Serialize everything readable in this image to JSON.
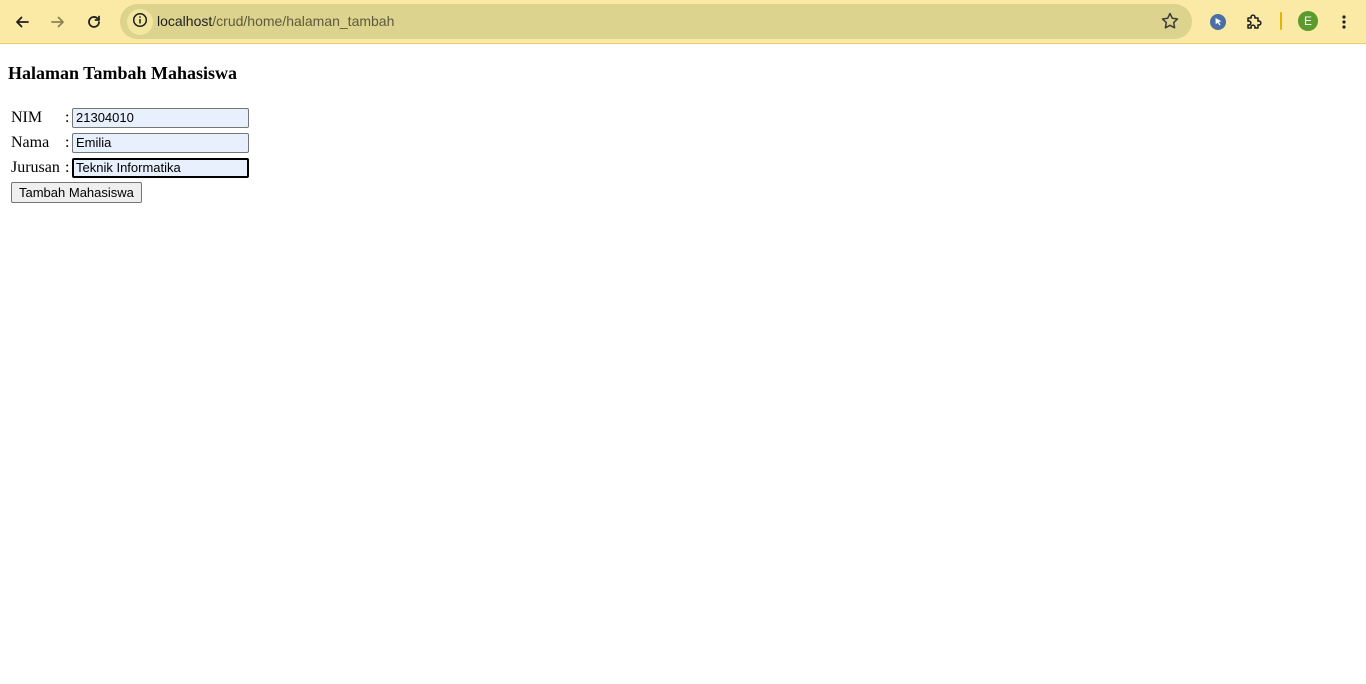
{
  "browser": {
    "url_host": "localhost",
    "url_path": "/crud/home/halaman_tambah",
    "profile_initial": "E",
    "icons": {
      "back": "back-arrow-icon",
      "forward": "forward-arrow-icon",
      "reload": "reload-icon",
      "site_info": "info-icon",
      "bookmark": "star-icon",
      "extension_1": "cursor-extension-icon",
      "extensions": "puzzle-icon",
      "menu": "kebab-menu-icon"
    },
    "colors": {
      "toolbar": "#fbe9a6",
      "omnibox": "#dcd38e",
      "avatar": "#5b9a2d"
    }
  },
  "page": {
    "heading": "Halaman Tambah Mahasiswa",
    "form": {
      "nim": {
        "label": "NIM",
        "colon": ":",
        "value": "21304010"
      },
      "nama": {
        "label": "Nama",
        "colon": ":",
        "value": "Emilia"
      },
      "jurusan": {
        "label": "Jurusan",
        "colon": ":",
        "value": "Teknik Informatika"
      },
      "submit_label": "Tambah Mahasiswa"
    }
  }
}
